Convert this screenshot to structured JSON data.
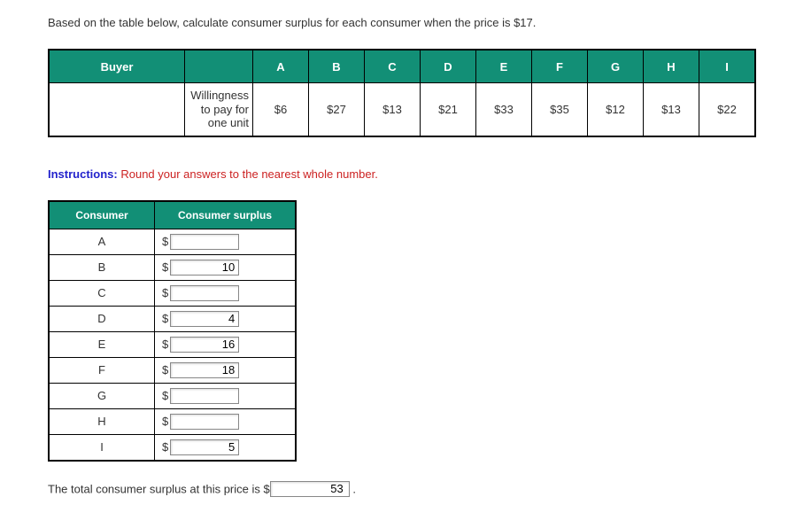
{
  "question": "Based on the table below, calculate consumer surplus for each consumer when the price is $17.",
  "wtp_table": {
    "header_buyer": "Buyer",
    "buyers": [
      "A",
      "B",
      "C",
      "D",
      "E",
      "F",
      "G",
      "H",
      "I"
    ],
    "row_label_l1": "Willingness",
    "row_label_l2": "to pay for",
    "row_label_l3": "one unit",
    "values": [
      "$6",
      "$27",
      "$13",
      "$21",
      "$33",
      "$35",
      "$12",
      "$13",
      "$22"
    ]
  },
  "instructions": {
    "label": "Instructions:",
    "text": " Round your answers to the nearest whole number."
  },
  "surplus_table": {
    "header_consumer": "Consumer",
    "header_surplus": "Consumer surplus",
    "rows": [
      {
        "consumer": "A",
        "value": ""
      },
      {
        "consumer": "B",
        "value": "10"
      },
      {
        "consumer": "C",
        "value": ""
      },
      {
        "consumer": "D",
        "value": "4"
      },
      {
        "consumer": "E",
        "value": "16"
      },
      {
        "consumer": "F",
        "value": "18"
      },
      {
        "consumer": "G",
        "value": ""
      },
      {
        "consumer": "H",
        "value": ""
      },
      {
        "consumer": "I",
        "value": "5"
      }
    ],
    "dollar": "$"
  },
  "total": {
    "prefix": "The total consumer surplus at this price is $",
    "value": "53",
    "suffix": "."
  }
}
